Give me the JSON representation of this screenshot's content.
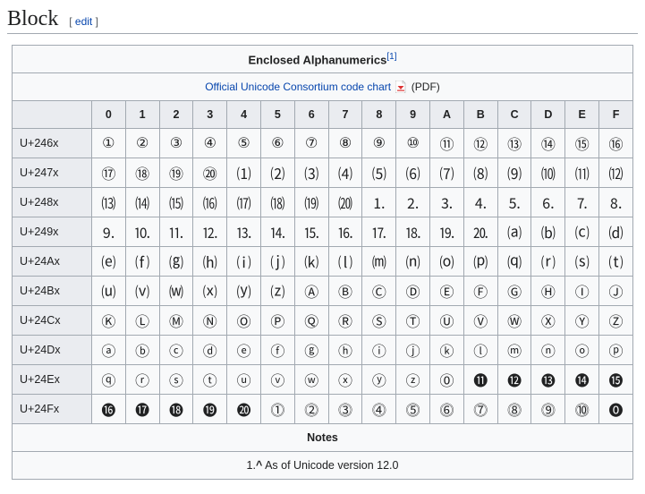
{
  "section": {
    "title": "Block",
    "edit_label": "edit"
  },
  "chart": {
    "title": "Enclosed Alphanumerics",
    "title_ref": "[1]",
    "subtitle_link": "Official Unicode Consortium code chart",
    "subtitle_suffix": " (PDF)"
  },
  "columns": [
    "0",
    "1",
    "2",
    "3",
    "4",
    "5",
    "6",
    "7",
    "8",
    "9",
    "A",
    "B",
    "C",
    "D",
    "E",
    "F"
  ],
  "chart_data": {
    "type": "table",
    "title": "Enclosed Alphanumerics Unicode block U+2460–U+24FF",
    "rows": [
      {
        "label": "U+246x",
        "cells": [
          "①",
          "②",
          "③",
          "④",
          "⑤",
          "⑥",
          "⑦",
          "⑧",
          "⑨",
          "⑩",
          "⑪",
          "⑫",
          "⑬",
          "⑭",
          "⑮",
          "⑯"
        ]
      },
      {
        "label": "U+247x",
        "cells": [
          "⑰",
          "⑱",
          "⑲",
          "⑳",
          "⑴",
          "⑵",
          "⑶",
          "⑷",
          "⑸",
          "⑹",
          "⑺",
          "⑻",
          "⑼",
          "⑽",
          "⑾",
          "⑿"
        ]
      },
      {
        "label": "U+248x",
        "cells": [
          "⒀",
          "⒁",
          "⒂",
          "⒃",
          "⒄",
          "⒅",
          "⒆",
          "⒇",
          "⒈",
          "⒉",
          "⒊",
          "⒋",
          "⒌",
          "⒍",
          "⒎",
          "⒏"
        ]
      },
      {
        "label": "U+249x",
        "cells": [
          "⒐",
          "⒑",
          "⒒",
          "⒓",
          "⒔",
          "⒕",
          "⒖",
          "⒗",
          "⒘",
          "⒙",
          "⒚",
          "⒛",
          "⒜",
          "⒝",
          "⒞",
          "⒟"
        ]
      },
      {
        "label": "U+24Ax",
        "cells": [
          "⒠",
          "⒡",
          "⒢",
          "⒣",
          "⒤",
          "⒥",
          "⒦",
          "⒧",
          "⒨",
          "⒩",
          "⒪",
          "⒫",
          "⒬",
          "⒭",
          "⒮",
          "⒯"
        ]
      },
      {
        "label": "U+24Bx",
        "cells": [
          "⒰",
          "⒱",
          "⒲",
          "⒳",
          "⒴",
          "⒵",
          "Ⓐ",
          "Ⓑ",
          "Ⓒ",
          "Ⓓ",
          "Ⓔ",
          "Ⓕ",
          "Ⓖ",
          "Ⓗ",
          "Ⓘ",
          "Ⓙ"
        ]
      },
      {
        "label": "U+24Cx",
        "cells": [
          "Ⓚ",
          "Ⓛ",
          "Ⓜ",
          "Ⓝ",
          "Ⓞ",
          "Ⓟ",
          "Ⓠ",
          "Ⓡ",
          "Ⓢ",
          "Ⓣ",
          "Ⓤ",
          "Ⓥ",
          "Ⓦ",
          "Ⓧ",
          "Ⓨ",
          "Ⓩ"
        ]
      },
      {
        "label": "U+24Dx",
        "cells": [
          "ⓐ",
          "ⓑ",
          "ⓒ",
          "ⓓ",
          "ⓔ",
          "ⓕ",
          "ⓖ",
          "ⓗ",
          "ⓘ",
          "ⓙ",
          "ⓚ",
          "ⓛ",
          "ⓜ",
          "ⓝ",
          "ⓞ",
          "ⓟ"
        ]
      },
      {
        "label": "U+24Ex",
        "cells": [
          "ⓠ",
          "ⓡ",
          "ⓢ",
          "ⓣ",
          "ⓤ",
          "ⓥ",
          "ⓦ",
          "ⓧ",
          "ⓨ",
          "ⓩ",
          "⓪",
          "⓫",
          "⓬",
          "⓭",
          "⓮",
          "⓯"
        ]
      },
      {
        "label": "U+24Fx",
        "cells": [
          "⓰",
          "⓱",
          "⓲",
          "⓳",
          "⓴",
          "⓵",
          "⓶",
          "⓷",
          "⓸",
          "⓹",
          "⓺",
          "⓻",
          "⓼",
          "⓽",
          "⓾",
          "⓿"
        ]
      }
    ]
  },
  "notes": {
    "heading": "Notes",
    "items": [
      {
        "num": "1.",
        "caret": "^",
        "text": " As of Unicode version 12.0"
      }
    ]
  }
}
